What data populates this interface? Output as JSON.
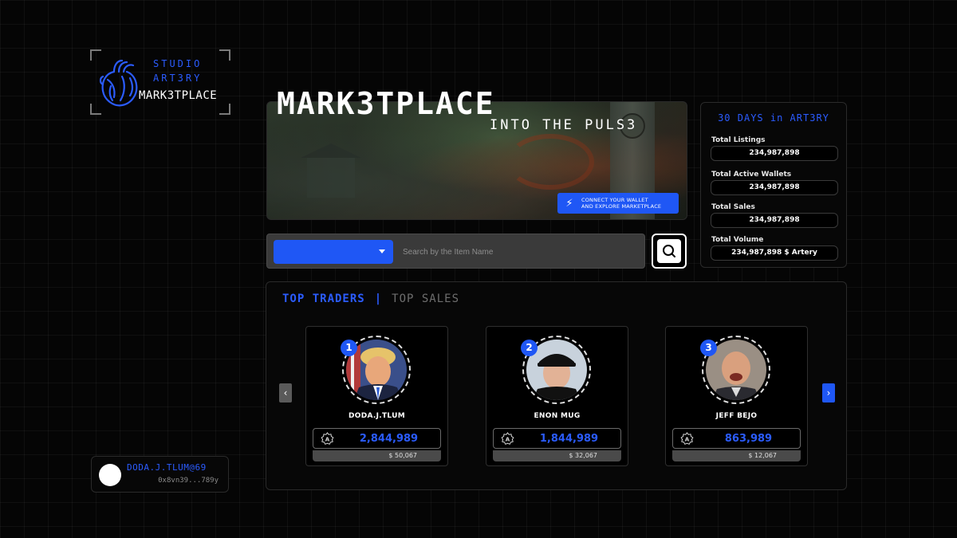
{
  "brand": {
    "line1": "STUDIO",
    "line2": "ART3RY",
    "line3": "MARK3TPLACE"
  },
  "user": {
    "name": "DODA.J.TLUM@69",
    "address": "0x8vn39...789y"
  },
  "hero": {
    "title": "MARK3TPLACE",
    "subtitle": "INTO THE PULS3",
    "connect_line1": "CONNECT YOUR WALLET",
    "connect_line2": "AND EXPLORE MARKETPLACE"
  },
  "stats": {
    "title": "30 DAYS in ART3RY",
    "items": [
      {
        "label": "Total Listings",
        "value": "234,987,898"
      },
      {
        "label": "Total Active Wallets",
        "value": "234,987,898"
      },
      {
        "label": "Total Sales",
        "value": "234,987,898"
      },
      {
        "label": "Total  Volume",
        "value": "234,987,898 $ Artery"
      }
    ]
  },
  "search": {
    "placeholder": "Search by the Item Name",
    "selected": ""
  },
  "tabs": {
    "active": "TOP TRADERS",
    "separator": "|",
    "inactive": "TOP SALES"
  },
  "traders": [
    {
      "rank": "1",
      "name": "DODA.J.TLUM",
      "value": "2,844,989",
      "usd": "$ 50,067"
    },
    {
      "rank": "2",
      "name": "ENON MUG",
      "value": "1,844,989",
      "usd": "$ 32,067"
    },
    {
      "rank": "3",
      "name": "JEFF BEJO",
      "value": "863,989",
      "usd": "$ 12,067"
    }
  ],
  "nav": {
    "prev": "‹",
    "next": "›"
  },
  "colors": {
    "accent": "#1f57f5",
    "accent_text": "#2b5cff",
    "background": "#050505"
  }
}
